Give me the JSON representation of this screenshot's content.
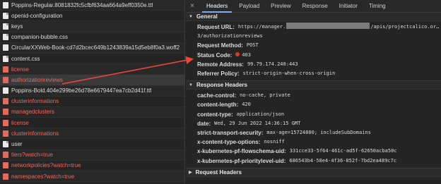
{
  "requests": [
    {
      "name": "Poppins-Regular.8081832fc5cfbf634aa664a9eff0350e.ttf",
      "status": "ok",
      "icon": "font"
    },
    {
      "name": "openid-configuration",
      "status": "ok",
      "icon": "doc"
    },
    {
      "name": "keys",
      "status": "ok",
      "icon": "doc"
    },
    {
      "name": "companion-bubble.css",
      "status": "ok",
      "icon": "doc"
    },
    {
      "name": "CircularXXWeb-Book-cd7d2bcec649b1243839a15d5eb8f0a3.woff2",
      "status": "ok",
      "icon": "font"
    },
    {
      "name": "content.css",
      "status": "ok",
      "icon": "doc"
    },
    {
      "name": "license",
      "status": "err",
      "icon": "red"
    },
    {
      "name": "authorizationreviews",
      "status": "err",
      "icon": "red",
      "selected": true
    },
    {
      "name": "Poppins-Bold.404e299be26d78e6679447ea7cb2d41f.ttf",
      "status": "ok",
      "icon": "font"
    },
    {
      "name": "clusterinformations",
      "status": "err",
      "icon": "red"
    },
    {
      "name": "managedclusters",
      "status": "err",
      "icon": "red"
    },
    {
      "name": "license",
      "status": "err",
      "icon": "red"
    },
    {
      "name": "clusterinformations",
      "status": "err",
      "icon": "red"
    },
    {
      "name": "user",
      "status": "ok",
      "icon": "doc"
    },
    {
      "name": "tiers?watch=true",
      "status": "err",
      "icon": "red"
    },
    {
      "name": "networkpolicies?watch=true",
      "status": "err",
      "icon": "red"
    },
    {
      "name": "namespaces?watch=true",
      "status": "err",
      "icon": "red"
    },
    {
      "name": "networksets?watch=true",
      "status": "err",
      "icon": "red"
    }
  ],
  "tabs": {
    "close": "×",
    "headers": "Headers",
    "payload": "Payload",
    "preview": "Preview",
    "response": "Response",
    "initiator": "Initiator",
    "timing": "Timing"
  },
  "general": {
    "title": "General",
    "request_url_label": "Request URL:",
    "request_url_prefix": "https://manager.",
    "request_url_suffix": "/apis/projectcalico.org/v",
    "request_url_cont": "3/authorizationreviews",
    "method_label": "Request Method:",
    "method": "POST",
    "status_label": "Status Code:",
    "status": "403",
    "remote_label": "Remote Address:",
    "remote": "99.79.174.240:443",
    "referrer_label": "Referrer Policy:",
    "referrer": "strict-origin-when-cross-origin"
  },
  "response_headers": {
    "title": "Response Headers",
    "rows": [
      {
        "k": "cache-control:",
        "v": "no-cache, private"
      },
      {
        "k": "content-length:",
        "v": "420"
      },
      {
        "k": "content-type:",
        "v": "application/json"
      },
      {
        "k": "date:",
        "v": "Wed, 29 Jun 2022 14:36:15 GMT"
      },
      {
        "k": "strict-transport-security:",
        "v": "max-age=15724800; includeSubDomains"
      },
      {
        "k": "x-content-type-options:",
        "v": "nosniff"
      },
      {
        "k": "x-kubernetes-pf-flowschema-uid:",
        "v": "331cce33-5f64-461c-ad5f-62650acba50c"
      },
      {
        "k": "x-kubernetes-pf-prioritylevel-uid:",
        "v": "686543b4-58e4-4f36-852f-7bd2ea489c7c"
      }
    ]
  },
  "request_headers": {
    "title": "Request Headers"
  },
  "colors": {
    "error": "#ee6a5d",
    "accent": "#7cacf8",
    "status_dot": "#e0352b",
    "arrow": "#e8473b"
  }
}
